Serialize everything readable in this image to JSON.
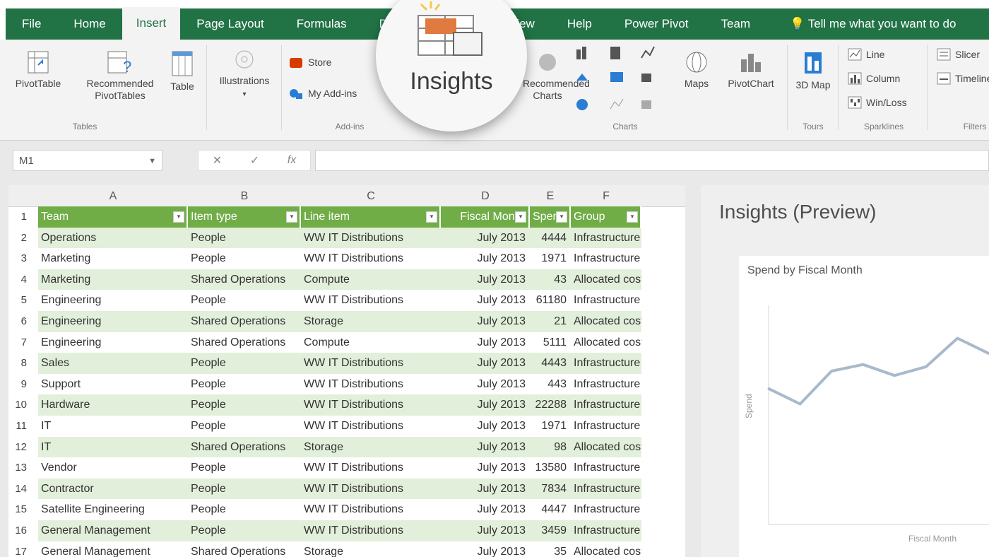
{
  "ribbon_tabs": [
    "File",
    "Home",
    "Insert",
    "Page Layout",
    "Formulas",
    "Data",
    "Review",
    "View",
    "Help",
    "Power Pivot",
    "Team"
  ],
  "active_tab": "Insert",
  "tell_me": "Tell me what you want to do",
  "ribbon": {
    "pivottable": "PivotTable",
    "recommended_pivottables": "Recommended PivotTables",
    "table": "Table",
    "illustrations": "Illustrations",
    "store": "Store",
    "my_addins": "My Add-ins",
    "recommended_charts": "Recommended Charts",
    "maps": "Maps",
    "pivotchart": "PivotChart",
    "map_3d": "3D Map",
    "line": "Line",
    "column": "Column",
    "win_loss": "Win/Loss",
    "slicer": "Slicer",
    "timeline": "Timeline",
    "groups": {
      "tables": "Tables",
      "addins": "Add-ins",
      "charts": "Charts",
      "tours": "Tours",
      "sparklines": "Sparklines",
      "filters": "Filters"
    }
  },
  "callout": {
    "label": "Insights"
  },
  "formula_bar": {
    "name_box": "M1",
    "cancel": "✕",
    "enter": "✓",
    "fx": "fx"
  },
  "columns": [
    "A",
    "B",
    "C",
    "D",
    "E",
    "F"
  ],
  "table": {
    "headers": [
      "Team",
      "Item type",
      "Line item",
      "Fiscal Month",
      "Spend",
      "Group"
    ],
    "rows": [
      [
        "Operations",
        "People",
        "WW IT Distributions",
        "July 2013",
        "4444",
        "Infrastructure"
      ],
      [
        "Marketing",
        "People",
        "WW IT Distributions",
        "July 2013",
        "1971",
        "Infrastructure"
      ],
      [
        "Marketing",
        "Shared Operations",
        "Compute",
        "July 2013",
        "43",
        "Allocated costs"
      ],
      [
        "Engineering",
        "People",
        "WW IT Distributions",
        "July 2013",
        "61180",
        "Infrastructure"
      ],
      [
        "Engineering",
        "Shared Operations",
        "Storage",
        "July 2013",
        "21",
        "Allocated costs"
      ],
      [
        "Engineering",
        "Shared Operations",
        "Compute",
        "July 2013",
        "5111",
        "Allocated costs"
      ],
      [
        "Sales",
        "People",
        "WW IT Distributions",
        "July 2013",
        "4443",
        "Infrastructure"
      ],
      [
        "Support",
        "People",
        "WW IT Distributions",
        "July 2013",
        "443",
        "Infrastructure"
      ],
      [
        "Hardware",
        "People",
        "WW IT Distributions",
        "July 2013",
        "22288",
        "Infrastructure"
      ],
      [
        "IT",
        "People",
        "WW IT Distributions",
        "July 2013",
        "1971",
        "Infrastructure"
      ],
      [
        "IT",
        "Shared Operations",
        "Storage",
        "July 2013",
        "98",
        "Allocated costs"
      ],
      [
        "Vendor",
        "People",
        "WW IT Distributions",
        "July 2013",
        "13580",
        "Infrastructure"
      ],
      [
        "Contractor",
        "People",
        "WW IT Distributions",
        "July 2013",
        "7834",
        "Infrastructure"
      ],
      [
        "Satellite Engineering",
        "People",
        "WW IT Distributions",
        "July 2013",
        "4447",
        "Infrastructure"
      ],
      [
        "General Management",
        "People",
        "WW IT Distributions",
        "July 2013",
        "3459",
        "Infrastructure"
      ],
      [
        "General Management",
        "Shared Operations",
        "Storage",
        "July 2013",
        "35",
        "Allocated costs"
      ]
    ]
  },
  "insights": {
    "title": "Insights (Preview)",
    "card_title": "Spend by Fiscal Month",
    "y_label": "Spend",
    "x_label": "Fiscal Month"
  },
  "chart_data": {
    "type": "line",
    "title": "Spend by Fiscal Month",
    "xlabel": "Fiscal Month",
    "ylabel": "Spend",
    "series": [
      {
        "values": [
          62,
          55,
          70,
          73,
          68,
          72,
          85,
          78
        ]
      }
    ],
    "ylim": [
      0,
      100
    ],
    "grid": false,
    "color": "#a9b9cc"
  },
  "colors": {
    "excel_green": "#217346",
    "table_header": "#70ad47",
    "band": "#e2efda"
  }
}
